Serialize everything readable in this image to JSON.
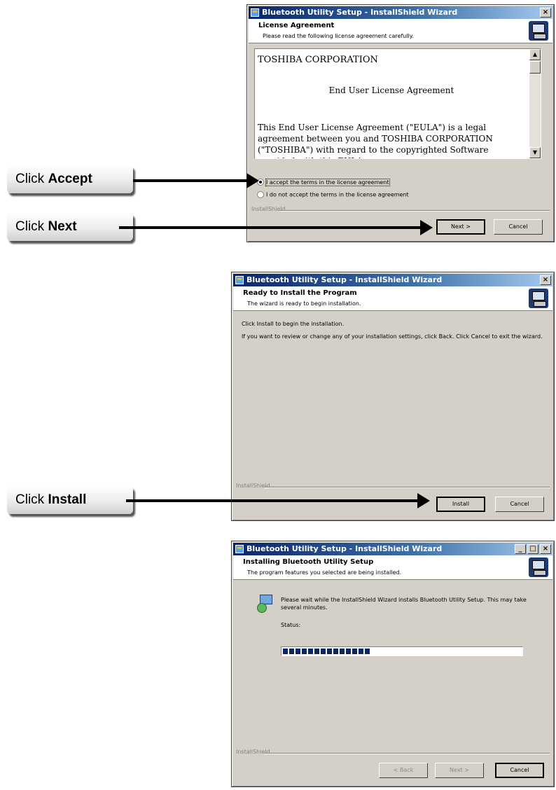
{
  "callouts": {
    "accept": {
      "prefix": "Click ",
      "bold": "Accept"
    },
    "next": {
      "prefix": "Click ",
      "bold": "Next"
    },
    "install": {
      "prefix": "Click ",
      "bold": "Install"
    }
  },
  "dialog1": {
    "title": "Bluetooth Utility Setup - InstallShield Wizard",
    "close_glyph": "×",
    "header_title": "License Agreement",
    "header_subtitle": "Please read the following license agreement carefully.",
    "eula_line1": "TOSHIBA CORPORATION",
    "eula_line2": "End User License Agreement",
    "eula_line3": "This End User License Agreement (\"EULA\") is a legal agreement between you and TOSHIBA CORPORATION (\"TOSHIBA\") with regard to the copyrighted Software provided with this EULA.",
    "radio_accept": "I accept the terms in the license agreement",
    "radio_decline": "I do not accept the terms in the license agreement",
    "brand_label": "InstallShield",
    "next_button": "Next >",
    "cancel_button": "Cancel",
    "selected_option": "accept"
  },
  "dialog2": {
    "title": "Bluetooth Utility Setup - InstallShield Wizard",
    "close_glyph": "×",
    "header_title": "Ready to Install the Program",
    "header_subtitle": "The wizard is ready to begin installation.",
    "body_line1": "Click Install to begin the installation.",
    "body_line2": "If you want to review or change any of your installation settings, click Back. Click Cancel to exit the wizard.",
    "brand_label": "InstallShield",
    "install_button": "Install",
    "cancel_button": "Cancel"
  },
  "dialog3": {
    "title": "Bluetooth Utility Setup - InstallShield Wizard",
    "minimize_glyph": "_",
    "maximize_glyph": "□",
    "close_glyph": "×",
    "header_title": "Installing Bluetooth Utility Setup",
    "header_subtitle": "The program features you selected are being installed.",
    "body_text": "Please wait while the InstallShield Wizard installs Bluetooth Utility Setup. This may take several minutes.",
    "status_label": "Status:",
    "progress_fraction": 0.37,
    "brand_label": "InstallShield",
    "back_button": "< Back",
    "next_button": "Next >",
    "cancel_button": "Cancel"
  }
}
